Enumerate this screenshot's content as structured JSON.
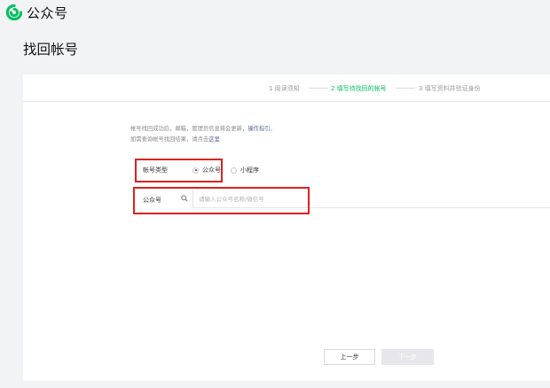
{
  "header": {
    "brand": "公众号",
    "logo_icon": "wechat-official-logo-icon",
    "accent": "#07c160"
  },
  "page": {
    "title": "找回帐号"
  },
  "steps": [
    {
      "label": "1 阅读须知",
      "active": false
    },
    {
      "label": "2 填写待找回的帐号",
      "active": true
    },
    {
      "label": "3 填写资料并验证身份",
      "active": false
    }
  ],
  "notice": {
    "line1_text": "帐号找回成功后，邮箱，管理员信息将会更新，",
    "line1_link": "操作指引",
    "line1_end": "。",
    "line2_text": "如需查询帐号找回结果，请点击",
    "line2_link": "这里"
  },
  "account_type": {
    "label": "帐号类型",
    "options": [
      {
        "label": "公众号",
        "selected": true
      },
      {
        "label": "小程序",
        "selected": false
      }
    ]
  },
  "search": {
    "label": "公众号",
    "icon": "search-icon",
    "placeholder": "请输入公众号名称/微信号",
    "value": ""
  },
  "buttons": {
    "prev": "上一步",
    "next": "下一步"
  },
  "highlight_color": "#e02020"
}
